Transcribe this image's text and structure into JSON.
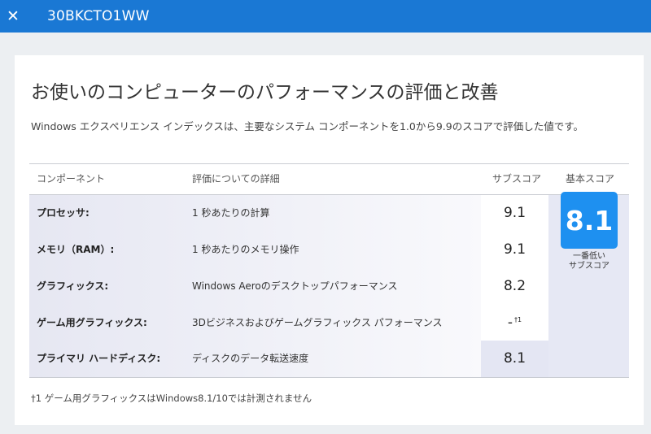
{
  "window": {
    "title": "30BKCTO1WW",
    "close_glyph": "✕"
  },
  "page": {
    "heading": "お使いのコンピューターのパフォーマンスの評価と改善",
    "description": "Windows エクスペリエンス インデックスは、主要なシステム コンポーネントを1.0から9.9のスコアで評価した値です。"
  },
  "table": {
    "headers": {
      "component": "コンポーネント",
      "detail": "評価についての詳細",
      "subscore": "サブスコア",
      "basescore": "基本スコア"
    },
    "rows": [
      {
        "component": "プロセッサ:",
        "detail": "1 秒あたりの計算",
        "subscore": "9.1",
        "note": ""
      },
      {
        "component": "メモリ（RAM）:",
        "detail": "1 秒あたりのメモリ操作",
        "subscore": "9.1",
        "note": ""
      },
      {
        "component": "グラフィックス:",
        "detail": "Windows Aeroのデスクトップパフォーマンス",
        "subscore": "8.2",
        "note": ""
      },
      {
        "component": "ゲーム用グラフィックス:",
        "detail": "3Dビジネスおよびゲームグラフィックス パフォーマンス",
        "subscore": "-",
        "note": "†1"
      },
      {
        "component": "プライマリ ハードディスク:",
        "detail": "ディスクのデータ転送速度",
        "subscore": "8.1",
        "note": ""
      }
    ],
    "base_score": "8.1",
    "base_caption_1": "一番低い",
    "base_caption_2": "サブスコア"
  },
  "footnote": "†1 ゲーム用グラフィックスはWindows8.1/10では計測されません",
  "colors": {
    "topbar": "#1a78d4",
    "badge": "#1e90f0",
    "background": "#eceff2"
  }
}
